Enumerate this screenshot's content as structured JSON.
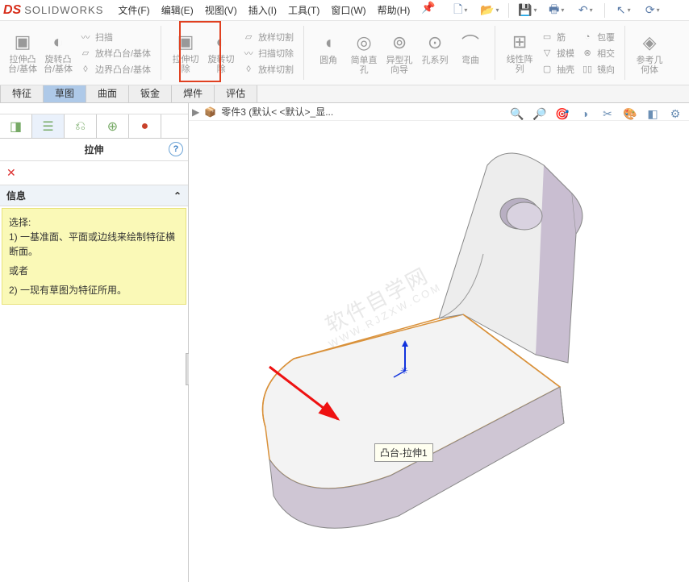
{
  "app": {
    "brand_prefix": "DS",
    "brand": "SOLIDWORKS"
  },
  "menu": {
    "file": "文件(F)",
    "edit": "编辑(E)",
    "view": "视图(V)",
    "insert": "插入(I)",
    "tools": "工具(T)",
    "window": "窗口(W)",
    "help": "帮助(H)"
  },
  "ribbon": {
    "extrude": "拉伸凸\n台/基体",
    "revolve": "旋转凸\n台/基体",
    "sweep": "扫描",
    "loft": "放样凸台/基体",
    "boundary": "边界凸台/基体",
    "extcut": "拉伸切\n除",
    "revcut": "旋转切\n除",
    "loftcut": "放样切割",
    "swcut": "扫描切除",
    "bndcut": "放样切割",
    "fillet": "圆角",
    "rect": "简单直\n孔",
    "hole": "异型孔\n向导",
    "series": "孔系列",
    "bend": "弯曲",
    "linpat": "线性阵\n列",
    "rib": "筋",
    "draft": "拔模",
    "shell": "抽壳",
    "wrap": "包覆",
    "intersect": "相交",
    "mirror": "镜向",
    "refgeom": "参考几\n何体"
  },
  "ftabs": {
    "feature": "特征",
    "sketch": "草图",
    "surface": "曲面",
    "sheet": "钣金",
    "weld": "焊件",
    "eval": "评估"
  },
  "panel": {
    "title": "拉伸",
    "info_head": "信息",
    "select": "选择:",
    "line1": "1) 一基准面、平面或边线来绘制特征横断面。",
    "or": "或者",
    "line2": "2) 一现有草图为特征所用。"
  },
  "crumb": {
    "part": "零件3  (默认< <默认>_显..."
  },
  "tooltip": "凸台-拉伸1",
  "watermark": {
    "l1": "软件自学网",
    "l2": "WWW.RJZXW.COM"
  }
}
